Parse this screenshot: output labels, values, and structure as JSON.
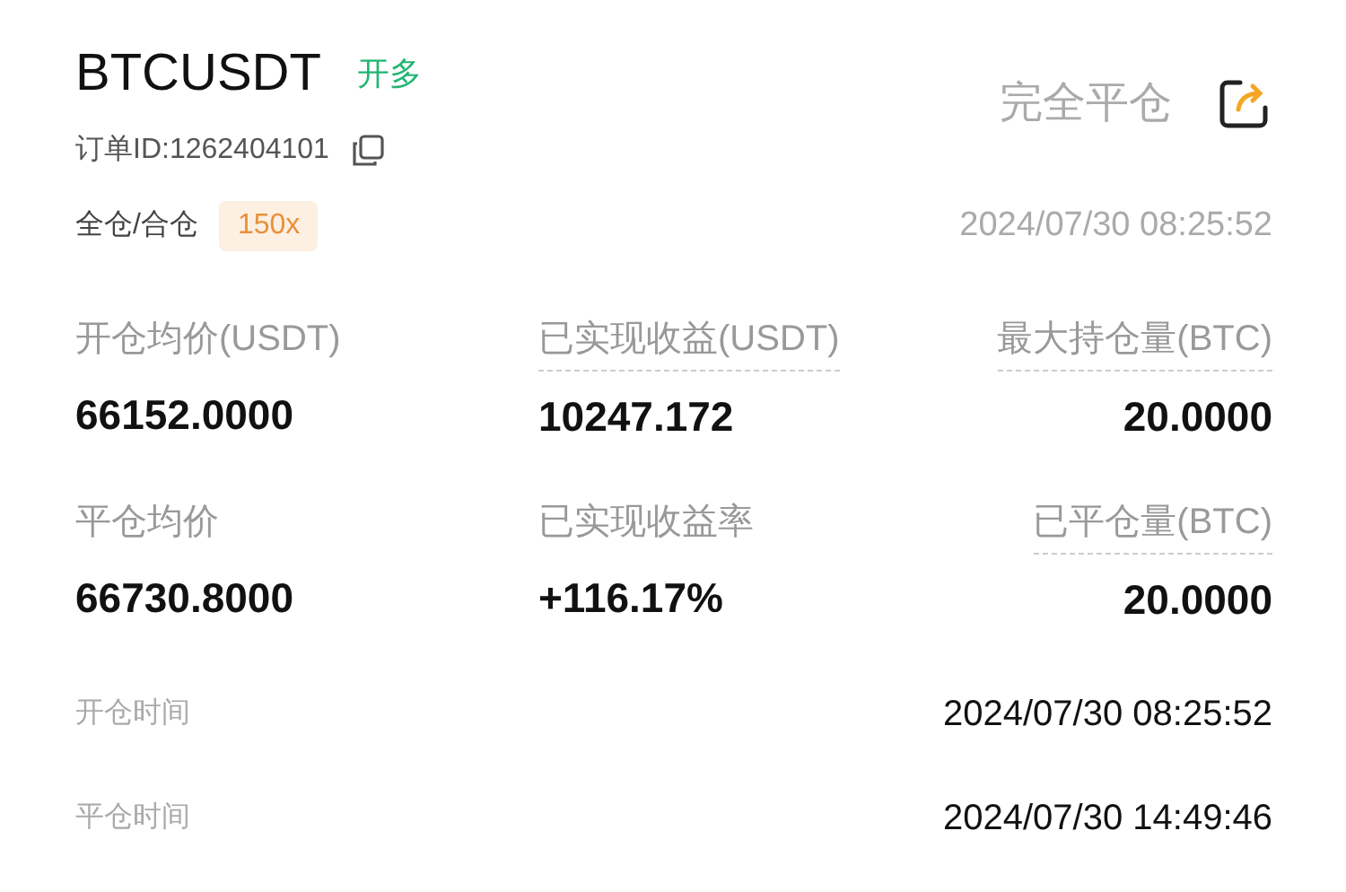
{
  "header": {
    "symbol": "BTCUSDT",
    "side": "开多",
    "order_id": "订单ID:1262404101",
    "close_all": "完全平仓"
  },
  "margin": {
    "mode": "全仓/合仓",
    "leverage": "150x",
    "time": "2024/07/30 08:25:52"
  },
  "metrics": [
    {
      "label": "开仓均价(USDT)",
      "value": "66152.0000",
      "underlined": false
    },
    {
      "label": "已实现收益(USDT)",
      "value": "10247.172",
      "underlined": true
    },
    {
      "label": "最大持仓量(BTC)",
      "value": "20.0000",
      "underlined": true
    },
    {
      "label": "平仓均价",
      "value": "66730.8000",
      "underlined": false
    },
    {
      "label": "已实现收益率",
      "value": "+116.17%",
      "underlined": false
    },
    {
      "label": "已平仓量(BTC)",
      "value": "20.0000",
      "underlined": true
    }
  ],
  "times": [
    {
      "label": "开仓时间",
      "value": "2024/07/30 08:25:52"
    },
    {
      "label": "平仓时间",
      "value": "2024/07/30 14:49:46"
    }
  ]
}
